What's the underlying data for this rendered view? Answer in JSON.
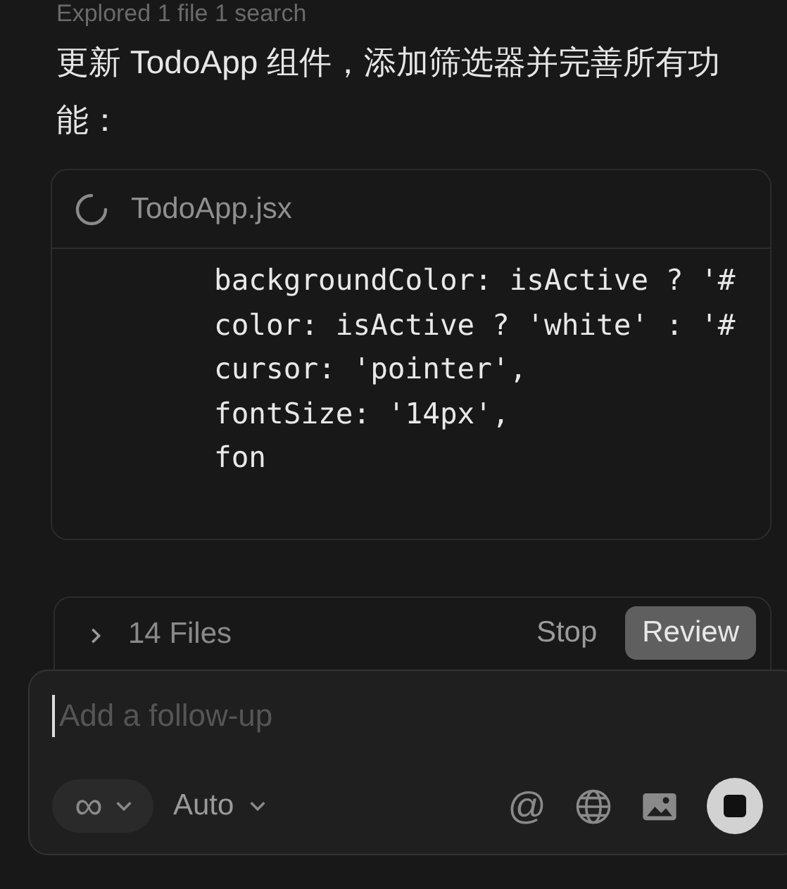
{
  "activity": {
    "summary": "Explored 1 file 1 search"
  },
  "message": {
    "text": "更新 TodoApp 组件，添加筛选器并完善所有功能："
  },
  "file_card": {
    "filename": "TodoApp.jsx",
    "loading": true,
    "code_lines": [
      "backgroundColor: isActive ? '#",
      "color: isActive ? 'white' : '#",
      "cursor: 'pointer',",
      "fontSize: '14px',",
      "fon"
    ]
  },
  "changes_bar": {
    "files_label": "14 Files",
    "expanded": false,
    "buttons": [
      {
        "label": "Stop",
        "kind": "plain"
      },
      {
        "label": "Review",
        "kind": "filled"
      }
    ]
  },
  "composer": {
    "placeholder": "Add a follow-up",
    "mode_symbol": "∞",
    "model": "Auto",
    "at_symbol": "@",
    "sending": true
  }
}
